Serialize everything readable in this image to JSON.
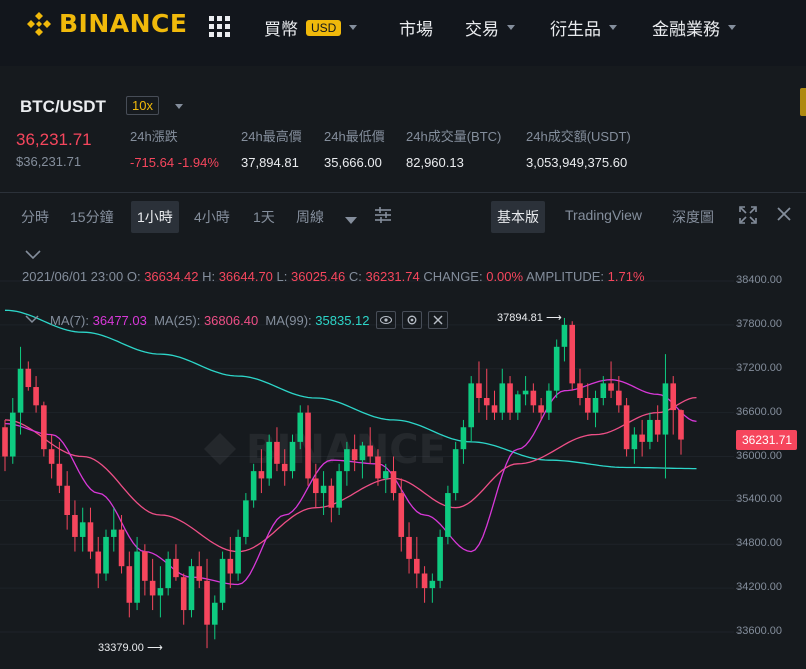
{
  "nav": {
    "logo_text": "BINANCE",
    "items": [
      {
        "label": "買幣",
        "badge": "USD"
      },
      {
        "label": "市場"
      },
      {
        "label": "交易"
      },
      {
        "label": "衍生品"
      },
      {
        "label": "金融業務"
      }
    ]
  },
  "ticker": {
    "symbol": "BTC/USDT",
    "leverage": "10x",
    "last_price": "36,231.71",
    "last_price_usd": "$36,231.71",
    "stats": [
      {
        "label": "24h漲跌",
        "value": "-715.64 -1.94%"
      },
      {
        "label": "24h最高價",
        "value": "37,894.81"
      },
      {
        "label": "24h最低價",
        "value": "35,666.00"
      },
      {
        "label": "24h成交量(BTC)",
        "value": "82,960.13"
      },
      {
        "label": "24h成交額(USDT)",
        "value": "3,053,949,375.60"
      }
    ]
  },
  "toolbar": {
    "intervals": [
      "分時",
      "15分鐘",
      "1小時",
      "4小時",
      "1天",
      "周線"
    ],
    "active_interval": "1小時",
    "views": [
      "基本版",
      "TradingView",
      "深度圖"
    ],
    "active_view": "基本版"
  },
  "chart_info": {
    "date": "2021/06/01 23:00",
    "o_label": "O:",
    "o": "36634.42",
    "h_label": "H:",
    "h": "36644.70",
    "l_label": "L:",
    "l": "36025.46",
    "c_label": "C:",
    "c": "36231.74",
    "change_label": "CHANGE:",
    "change": "0.00%",
    "amplitude_label": "AMPLITUDE:",
    "amplitude": "1.71%",
    "ma7_label": "MA(7):",
    "ma7": "36477.03",
    "ma25_label": "MA(25):",
    "ma25": "36806.40",
    "ma99_label": "MA(99):",
    "ma99": "35835.12",
    "high_marker": "37894.81",
    "low_marker": "33379.00",
    "current_price_tag": "36231.71"
  },
  "chart_data": {
    "type": "candlestick",
    "y_ticks": [
      "38400.00",
      "37800.00",
      "37200.00",
      "36600.00",
      "36000.00",
      "35400.00",
      "34800.00",
      "34200.00",
      "33600.00"
    ],
    "ylim": [
      33300,
      38800
    ],
    "candles": [
      [
        36400,
        36500,
        35800,
        36000
      ],
      [
        36000,
        36800,
        35900,
        36600
      ],
      [
        36600,
        37500,
        36300,
        37200
      ],
      [
        37200,
        37300,
        36900,
        36950
      ],
      [
        36950,
        37100,
        36600,
        36700
      ],
      [
        36700,
        36750,
        36000,
        36100
      ],
      [
        36100,
        36300,
        35700,
        35900
      ],
      [
        35900,
        36200,
        35500,
        35600
      ],
      [
        35600,
        35800,
        35000,
        35200
      ],
      [
        35200,
        35400,
        34700,
        34900
      ],
      [
        34900,
        35300,
        34700,
        35100
      ],
      [
        35100,
        35300,
        34600,
        34700
      ],
      [
        34700,
        34900,
        34200,
        34400
      ],
      [
        34400,
        35000,
        34300,
        34900
      ],
      [
        34900,
        35300,
        34700,
        35000
      ],
      [
        35000,
        35200,
        34400,
        34500
      ],
      [
        34500,
        34700,
        33800,
        34000
      ],
      [
        34000,
        34900,
        33900,
        34700
      ],
      [
        34700,
        34800,
        34100,
        34300
      ],
      [
        34300,
        34600,
        33900,
        34100
      ],
      [
        34100,
        34500,
        33800,
        34200
      ],
      [
        34200,
        34700,
        34100,
        34600
      ],
      [
        34600,
        34800,
        34300,
        34350
      ],
      [
        34350,
        34400,
        33700,
        33900
      ],
      [
        33900,
        34600,
        33800,
        34500
      ],
      [
        34500,
        34700,
        34200,
        34300
      ],
      [
        34300,
        34600,
        33379,
        33700
      ],
      [
        33700,
        34100,
        33500,
        34000
      ],
      [
        34000,
        34700,
        33900,
        34600
      ],
      [
        34600,
        34900,
        34200,
        34400
      ],
      [
        34400,
        35000,
        34300,
        34900
      ],
      [
        34900,
        35500,
        34800,
        35400
      ],
      [
        35400,
        35900,
        35300,
        35800
      ],
      [
        35800,
        36100,
        35500,
        35700
      ],
      [
        35700,
        36300,
        35600,
        36200
      ],
      [
        36200,
        36400,
        35800,
        35900
      ],
      [
        35900,
        36100,
        35600,
        35800
      ],
      [
        35800,
        36300,
        35700,
        36200
      ],
      [
        36200,
        36700,
        36100,
        36600
      ],
      [
        36600,
        36700,
        35600,
        35700
      ],
      [
        35700,
        35900,
        35300,
        35500
      ],
      [
        35500,
        35800,
        35200,
        35600
      ],
      [
        35600,
        35700,
        35100,
        35300
      ],
      [
        35300,
        35900,
        35200,
        35800
      ],
      [
        35800,
        36200,
        35600,
        36100
      ],
      [
        36100,
        36300,
        35800,
        35950
      ],
      [
        35950,
        36200,
        35700,
        36150
      ],
      [
        36150,
        36400,
        35900,
        36000
      ],
      [
        36000,
        36100,
        35600,
        35700
      ],
      [
        35700,
        35900,
        35500,
        35800
      ],
      [
        35800,
        36000,
        35400,
        35500
      ],
      [
        35500,
        35700,
        34700,
        34900
      ],
      [
        34900,
        35100,
        34400,
        34600
      ],
      [
        34600,
        34900,
        34200,
        34400
      ],
      [
        34400,
        34500,
        34000,
        34200
      ],
      [
        34200,
        34400,
        34000,
        34300
      ],
      [
        34300,
        35000,
        34200,
        34900
      ],
      [
        34900,
        35600,
        34800,
        35500
      ],
      [
        35500,
        36200,
        35400,
        36100
      ],
      [
        36100,
        36500,
        35900,
        36400
      ],
      [
        36400,
        37100,
        36200,
        37000
      ],
      [
        37000,
        37300,
        36600,
        36800
      ],
      [
        36800,
        37200,
        36500,
        36700
      ],
      [
        36700,
        36900,
        36500,
        36600
      ],
      [
        36600,
        37200,
        36500,
        37000
      ],
      [
        37000,
        37100,
        36500,
        36600
      ],
      [
        36600,
        36900,
        36500,
        36850
      ],
      [
        36850,
        37100,
        36700,
        36900
      ],
      [
        36900,
        37000,
        36600,
        36700
      ],
      [
        36700,
        36800,
        36500,
        36600
      ],
      [
        36600,
        37000,
        36500,
        36900
      ],
      [
        36900,
        37600,
        36800,
        37500
      ],
      [
        37500,
        37894.81,
        37300,
        37800
      ],
      [
        37800,
        37850,
        36900,
        37000
      ],
      [
        37000,
        37200,
        36700,
        36800
      ],
      [
        36800,
        37000,
        36500,
        36600
      ],
      [
        36600,
        36900,
        36400,
        36800
      ],
      [
        36800,
        37100,
        36700,
        37000
      ],
      [
        37000,
        37300,
        36800,
        36900
      ],
      [
        36900,
        37100,
        36600,
        36700
      ],
      [
        36700,
        36800,
        36000,
        36100
      ],
      [
        36100,
        36400,
        35900,
        36300
      ],
      [
        36300,
        36500,
        36000,
        36200
      ],
      [
        36200,
        36600,
        36100,
        36500
      ],
      [
        36500,
        36700,
        36200,
        36300
      ],
      [
        36300,
        37400,
        35700,
        37000
      ],
      [
        37000,
        37100,
        36300,
        36634.42
      ],
      [
        36634.42,
        36644.7,
        36025.46,
        36231.74
      ]
    ],
    "ma7": [
      [
        0,
        36450
      ],
      [
        6,
        36300
      ],
      [
        12,
        35500
      ],
      [
        18,
        34700
      ],
      [
        24,
        34350
      ],
      [
        30,
        34250
      ],
      [
        36,
        35200
      ],
      [
        42,
        35950
      ],
      [
        48,
        35900
      ],
      [
        54,
        35200
      ],
      [
        60,
        34700
      ],
      [
        66,
        36100
      ],
      [
        72,
        36900
      ],
      [
        78,
        37050
      ],
      [
        84,
        36850
      ],
      [
        89,
        36480
      ]
    ],
    "ma25": [
      [
        0,
        36500
      ],
      [
        10,
        36000
      ],
      [
        20,
        35200
      ],
      [
        30,
        34700
      ],
      [
        40,
        35300
      ],
      [
        50,
        35700
      ],
      [
        58,
        35300
      ],
      [
        66,
        35900
      ],
      [
        76,
        36300
      ],
      [
        84,
        36600
      ],
      [
        89,
        36806
      ]
    ],
    "ma99": [
      [
        0,
        38000
      ],
      [
        10,
        37700
      ],
      [
        20,
        37400
      ],
      [
        30,
        37100
      ],
      [
        40,
        36800
      ],
      [
        50,
        36500
      ],
      [
        60,
        36200
      ],
      [
        70,
        35950
      ],
      [
        80,
        35850
      ],
      [
        89,
        35835
      ]
    ]
  }
}
